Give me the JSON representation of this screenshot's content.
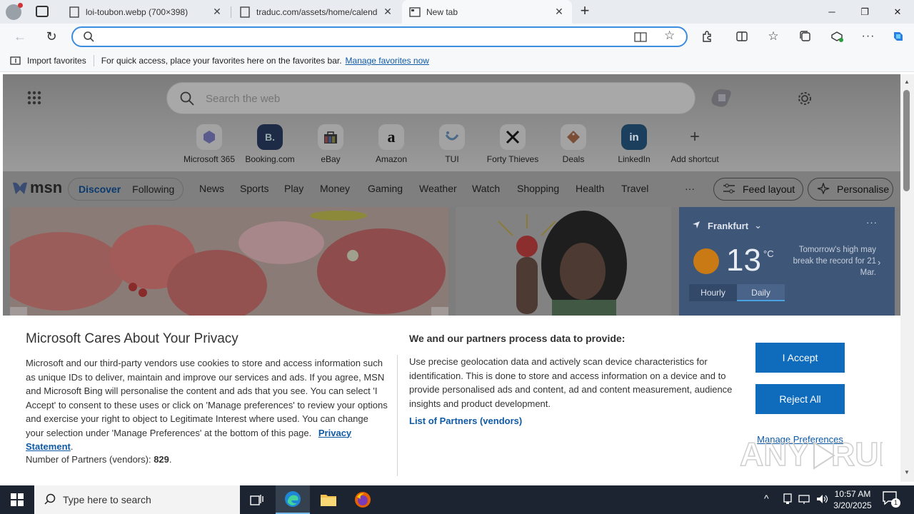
{
  "browser": {
    "tabs": [
      {
        "title": "loi-toubon.webp (700×398)"
      },
      {
        "title": "traduc.com/assets/home/calend"
      },
      {
        "title": "New tab"
      }
    ],
    "address": {
      "value": "",
      "placeholder": ""
    },
    "favorites_bar": {
      "import_label": "Import favorites",
      "message": "For quick access, place your favorites here on the favorites bar.",
      "manage_link": "Manage favorites now"
    }
  },
  "newtab": {
    "search_placeholder": "Search the web",
    "shortcuts": [
      {
        "label": "Microsoft 365"
      },
      {
        "label": "Booking.com",
        "glyph": "B."
      },
      {
        "label": "eBay"
      },
      {
        "label": "Amazon",
        "glyph": "a"
      },
      {
        "label": "TUI"
      },
      {
        "label": "Forty Thieves"
      },
      {
        "label": "Deals"
      },
      {
        "label": "LinkedIn",
        "glyph": "in"
      },
      {
        "label": "Add shortcut",
        "glyph": "+"
      }
    ],
    "msn": {
      "logo": "msn",
      "toggle": [
        "Discover",
        "Following"
      ],
      "nav": [
        "News",
        "Sports",
        "Play",
        "Money",
        "Gaming",
        "Weather",
        "Watch",
        "Shopping",
        "Health",
        "Travel"
      ],
      "more": "···",
      "feed_layout": "Feed layout",
      "personalise": "Personalise"
    },
    "weather": {
      "location": "Frankfurt",
      "temp": "13",
      "unit": "°C",
      "alert": "Tomorrow's high may break the record for 21 Mar.",
      "tabs": [
        "Hourly",
        "Daily"
      ]
    }
  },
  "consent": {
    "title": "Microsoft Cares About Your Privacy",
    "body": "Microsoft and our third-party vendors use cookies to store and access information such as unique IDs to deliver, maintain and improve our services and ads. If you agree, MSN and Microsoft Bing will personalise the content and ads that you see. You can select 'I Accept' to consent to these uses or click on 'Manage preferences' to review your options and exercise your right to object to Legitimate Interest where used.  You can change your selection under 'Manage Preferences' at the bottom of this page.",
    "privacy_link": "Privacy Statement",
    "partners_label": "Number of Partners (vendors):",
    "partners_count": "829",
    "process_title": "We and our partners process data to provide:",
    "process_body": "Use precise geolocation data and actively scan device characteristics for identification. This is done to store and access information on a device and to provide personalised ads and content, ad and content measurement, audience insights and product development.",
    "list_link": "List of Partners (vendors)",
    "accept": "I Accept",
    "reject": "Reject All",
    "manage": "Manage Preferences"
  },
  "taskbar": {
    "search_placeholder": "Type here to search",
    "time": "10:57 AM",
    "date": "3/20/2025",
    "notif_count": "1"
  },
  "colors": {
    "accent": "#0f6cbd",
    "link": "#0f5aa6",
    "taskbar": "#1b2430"
  }
}
